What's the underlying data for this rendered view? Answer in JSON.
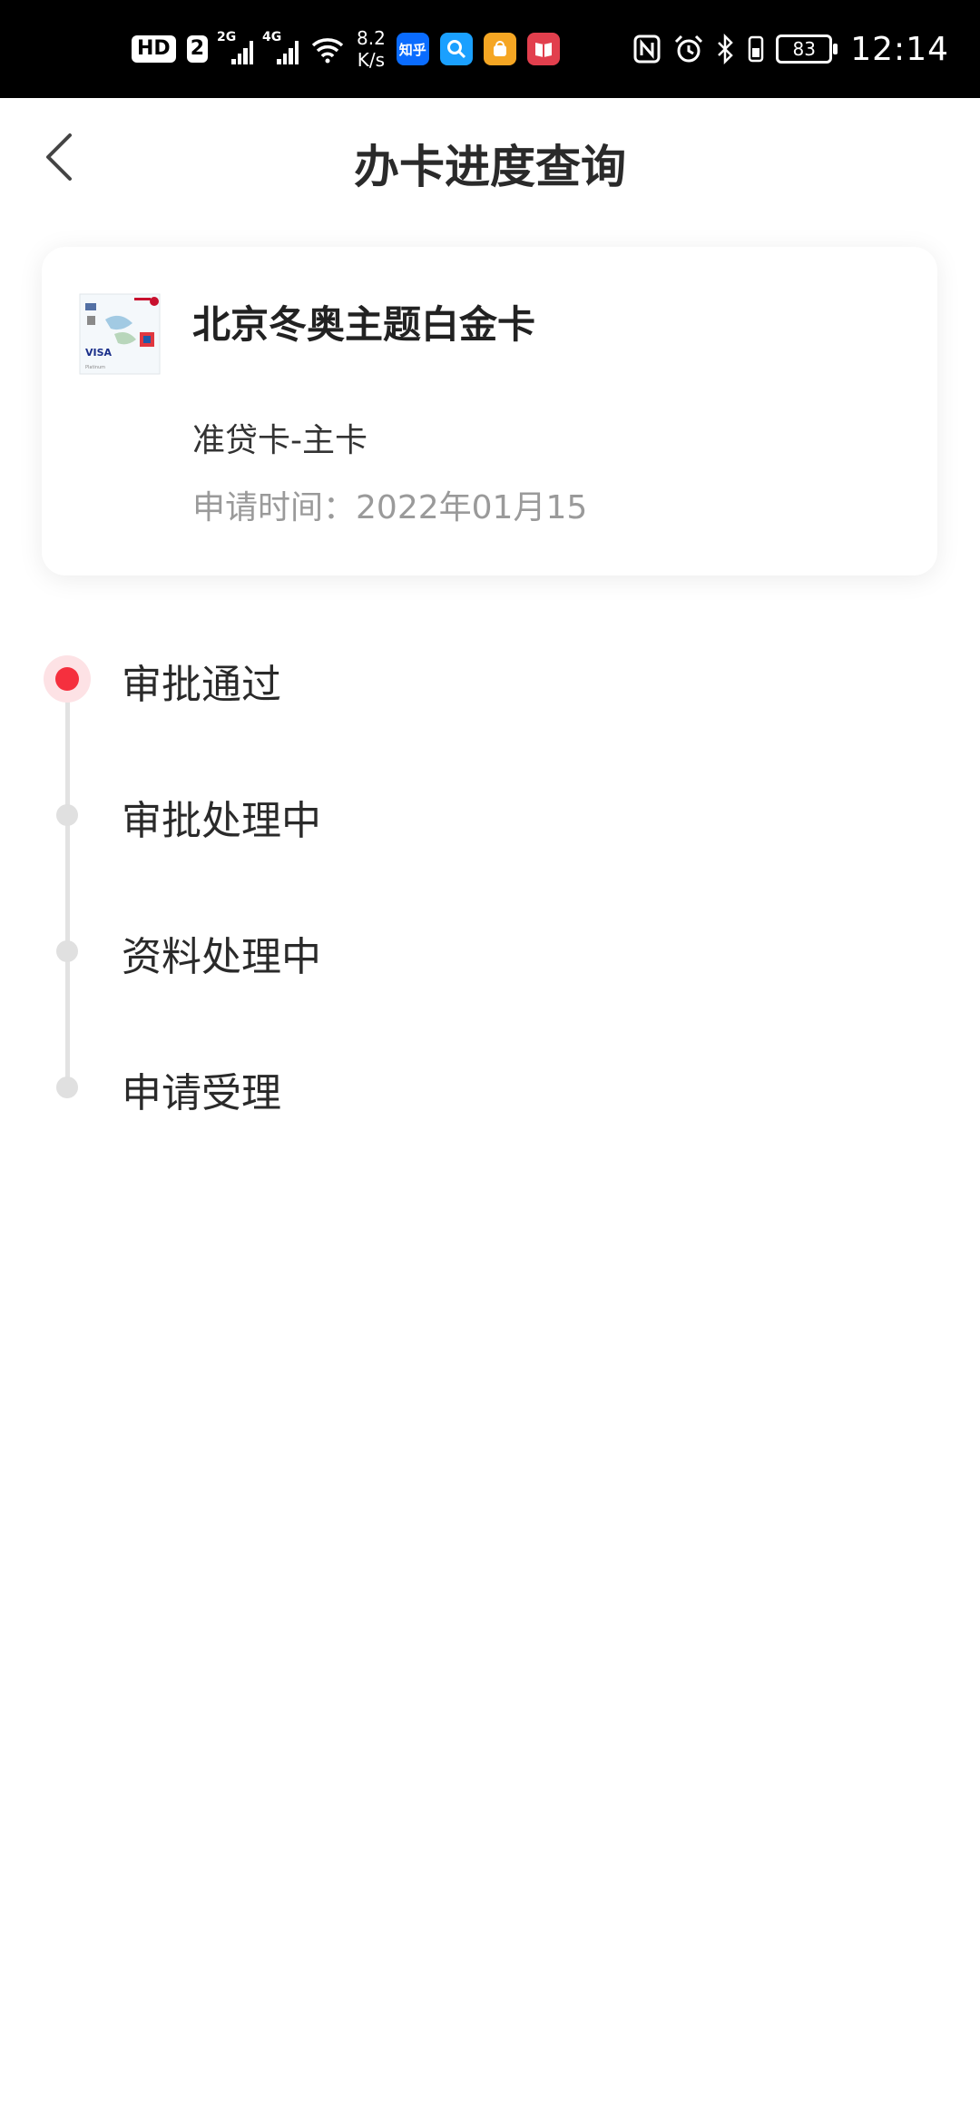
{
  "status_bar": {
    "hd_label": "HD",
    "sim_label": "2",
    "net1_label": "2G",
    "net2_label": "4G",
    "speed_value": "8.2",
    "speed_unit": "K/s",
    "app_zhihu_label": "知乎",
    "battery_level": "83",
    "time": "12:14",
    "icons": [
      "nfc-icon",
      "alarm-icon",
      "bluetooth-icon",
      "vibrate-icon"
    ]
  },
  "header": {
    "title": "办卡进度查询"
  },
  "card": {
    "name": "北京冬奥主题白金卡",
    "type": "准贷卡-主卡",
    "date_label": "申请时间：",
    "date_value": "2022年01月15"
  },
  "timeline": {
    "steps": [
      {
        "label": "审批通过",
        "active": true
      },
      {
        "label": "审批处理中",
        "active": false
      },
      {
        "label": "资料处理中",
        "active": false
      },
      {
        "label": "申请受理",
        "active": false
      }
    ]
  },
  "colors": {
    "accent": "#f5303e",
    "accent_halo": "#fde2e5",
    "inactive_dot": "#e0e0e0",
    "muted_text": "#9a9a9a"
  }
}
